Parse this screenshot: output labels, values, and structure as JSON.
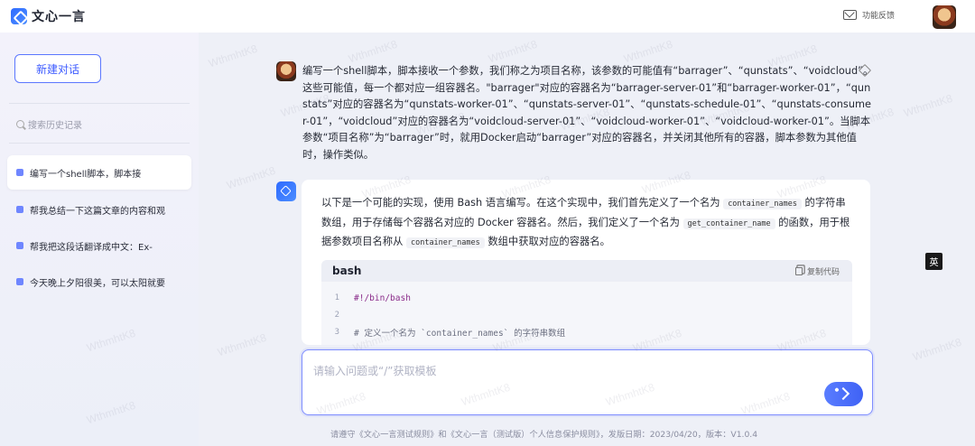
{
  "app": {
    "title": "文心一言"
  },
  "header": {
    "feedback_label": "功能反馈"
  },
  "sidebar": {
    "new_chat_label": "新建对话",
    "search_placeholder": "搜索历史记录",
    "items": [
      {
        "label": "编写一个shell脚本，脚本接",
        "active": true
      },
      {
        "label": "帮我总结一下这篇文章的内容和观",
        "active": false
      },
      {
        "label": "帮我把这段话翻译成中文：Ex-",
        "active": false
      },
      {
        "label": "今天晚上夕阳很美，可以太阳就要",
        "active": false
      }
    ]
  },
  "conversation": {
    "user_message": "编写一个shell脚本，脚本接收一个参数，我们称之为项目名称，该参数的可能值有“barrager”、“qunstats”、“voidcloud”。这些可能值，每一个都对应一组容器名。\"barrager\"对应的容器名为“barrager-server-01”和“barrager-worker-01”，“qunstats”对应的容器名为“qunstats-worker-01”、“qunstats-server-01”、“qunstats-schedule-01”、“qunstats-consumer-01”，“voidcloud”对应的容器名为“voidcloud-server-01”、“voidcloud-worker-01”、“voidcloud-worker-01”。当脚本参数“项目名称”为“barrager”时，就用Docker启动“barrager”对应的容器名，并关闭其他所有的容器，脚本参数为其他值时，操作类似。",
    "answer": {
      "intro_1": "以下是一个可能的实现，使用 Bash 语言编写。在这个实现中，我们首先定义了一个名为 ",
      "code_1": "container_names",
      "intro_2": " 的字符串数组，用于存储每个容器名对应的 Docker 容器名。然后，我们定义了一个名为 ",
      "code_2": "get_container_name",
      "intro_3": " 的函数，用于根据参数项目名称从 ",
      "code_3": "container_names",
      "intro_4": " 数组中获取对应的容器名。",
      "code_block": {
        "language": "bash",
        "copy_label": "复制代码",
        "lines": [
          {
            "num": "1",
            "text": "#!/bin/bash"
          },
          {
            "num": "2",
            "text": ""
          },
          {
            "num": "3",
            "text": "# 定义一个名为 `container_names` 的字符串数组"
          }
        ]
      }
    }
  },
  "input": {
    "placeholder": "请输入问题或“/”获取模板"
  },
  "footer": {
    "text": "请遵守《文心一言测试规则》和《文心一言（测试版）个人信息保护规则》，发版日期：2023/04/20，版本：V1.0.4"
  },
  "translate_badge": "英",
  "watermark": "WthmhtK8",
  "colors": {
    "accent": "#3d5bff",
    "sidebar_bg": "#f3f2fb",
    "main_bg": "#eef0f7"
  }
}
